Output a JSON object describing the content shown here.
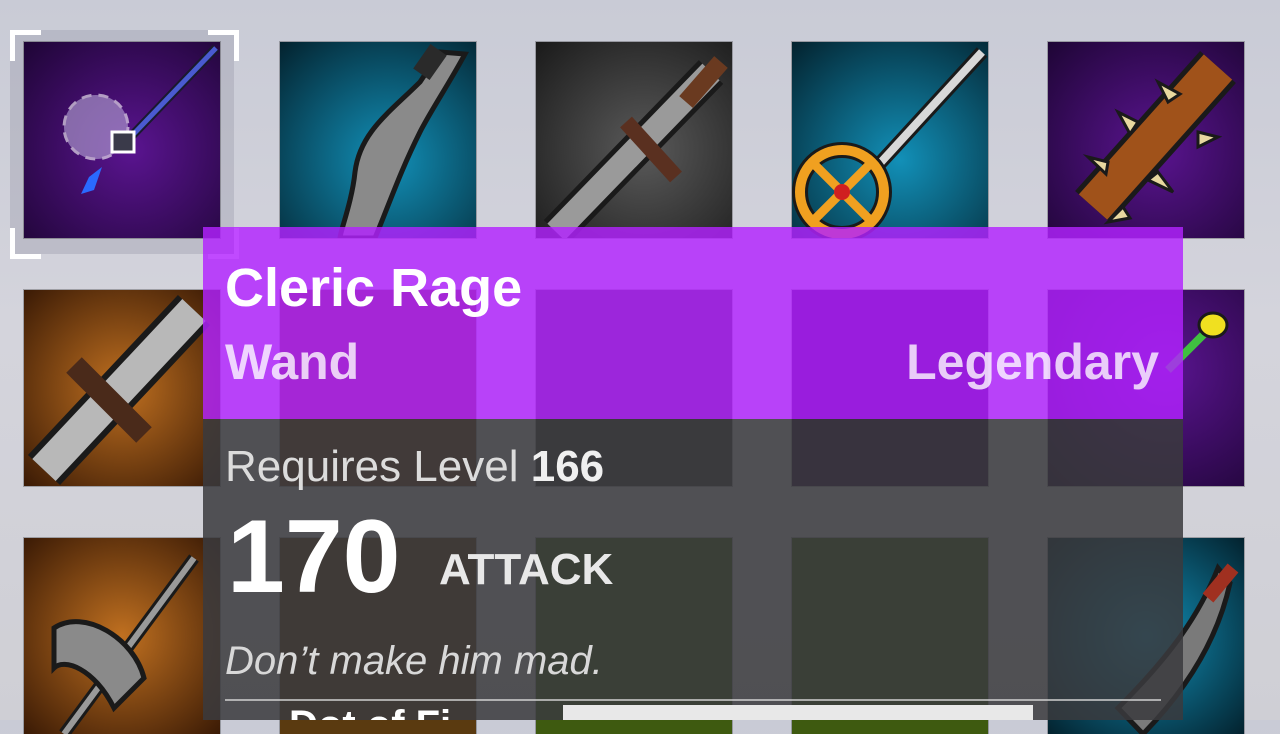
{
  "inventory": {
    "selected_slot": 0,
    "slots": [
      {
        "name": "Cleric Rage",
        "icon": "wand-icon",
        "bg": "#3a0a5e"
      },
      {
        "name": "",
        "icon": "curved-blade-icon",
        "bg": "#0c6a8a"
      },
      {
        "name": "",
        "icon": "broadsword-icon",
        "bg": "#3a3a3a"
      },
      {
        "name": "",
        "icon": "sun-staff-icon",
        "bg": "#0c6a8a"
      },
      {
        "name": "",
        "icon": "spiked-club-icon",
        "bg": "#3a0a5e"
      },
      {
        "name": "",
        "icon": "greatsword-icon",
        "bg": "#8a4a10"
      },
      {
        "name": "",
        "icon": "sword-icon",
        "bg": "#8a4a10"
      },
      {
        "name": "",
        "icon": "trident-icon",
        "bg": "#3a3a3a"
      },
      {
        "name": "",
        "icon": "hammer-icon",
        "bg": "#3a0a5e"
      },
      {
        "name": "",
        "icon": "gem-staff-icon",
        "bg": "#3a0a5e"
      },
      {
        "name": "",
        "icon": "axe-icon",
        "bg": "#8a4a10"
      },
      {
        "name": "",
        "icon": "battleaxe-icon",
        "bg": "#5a3a10"
      },
      {
        "name": "",
        "icon": "axe-icon",
        "bg": "#3e5a10"
      },
      {
        "name": "",
        "icon": "sword-icon",
        "bg": "#3e5a10"
      },
      {
        "name": "",
        "icon": "scimitar-icon",
        "bg": "#0c6a8a"
      }
    ]
  },
  "tooltip": {
    "name": "Cleric Rage",
    "type": "Wand",
    "rarity": "Legendary",
    "requires_label": "Requires Level",
    "requires_level": "166",
    "attack_value": "170",
    "attack_label": "ATTACK",
    "flavor": "Don’t make him mad.",
    "next_line": "Dot of Fi",
    "header_color": "#b222ff"
  }
}
